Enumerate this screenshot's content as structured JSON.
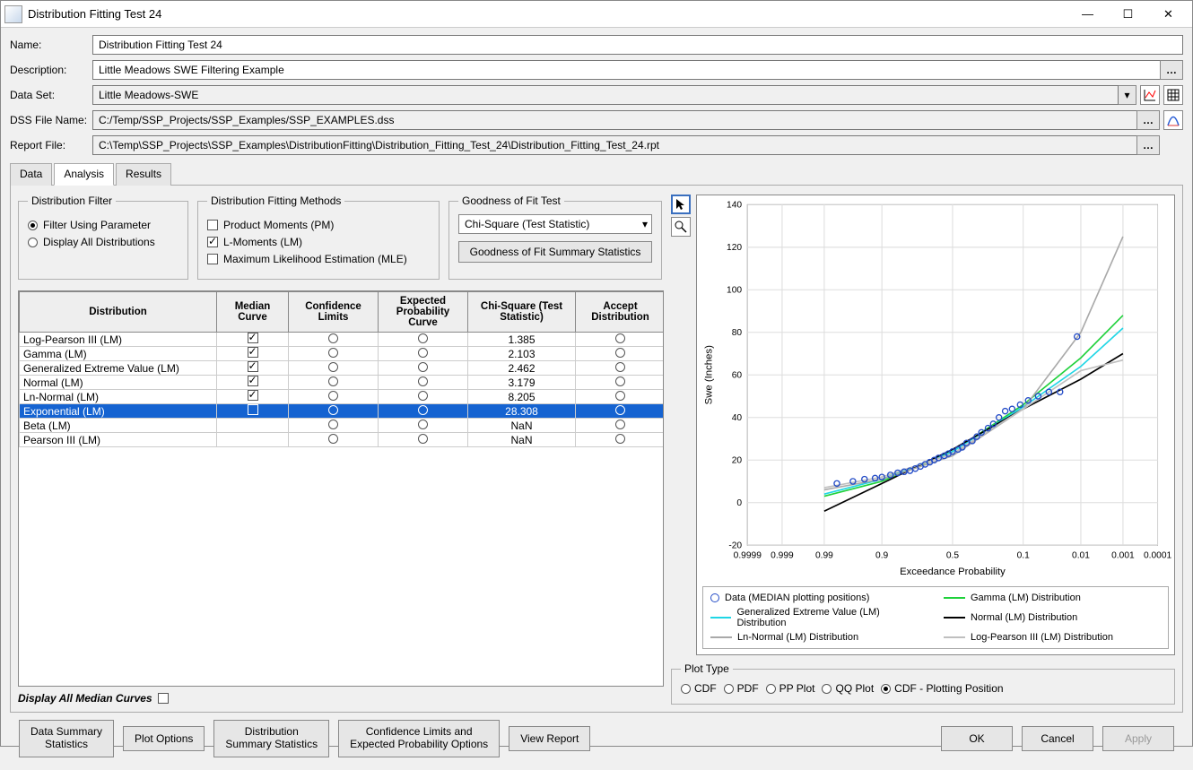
{
  "window": {
    "title": "Distribution Fitting Test 24"
  },
  "form": {
    "name_label": "Name:",
    "name_value": "Distribution Fitting Test 24",
    "description_label": "Description:",
    "description_value": "Little Meadows SWE Filtering Example",
    "dataset_label": "Data Set:",
    "dataset_value": "Little Meadows-SWE",
    "dssfile_label": "DSS File Name:",
    "dssfile_value": "C:/Temp/SSP_Projects/SSP_Examples/SSP_EXAMPLES.dss",
    "report_label": "Report File:",
    "report_value": "C:\\Temp\\SSP_Projects\\SSP_Examples\\DistributionFitting\\Distribution_Fitting_Test_24\\Distribution_Fitting_Test_24.rpt"
  },
  "tabs": {
    "data": "Data",
    "analysis": "Analysis",
    "results": "Results"
  },
  "groups": {
    "dist_filter": {
      "legend": "Distribution Filter",
      "opt_filter": "Filter Using Parameter",
      "opt_display_all": "Display All Distributions"
    },
    "fit_methods": {
      "legend": "Distribution Fitting Methods",
      "pm": "Product Moments (PM)",
      "lm": "L-Moments (LM)",
      "mle": "Maximum Likelihood Estimation (MLE)"
    },
    "gof": {
      "legend": "Goodness of Fit Test",
      "selected": "Chi-Square (Test Statistic)",
      "button": "Goodness of Fit Summary Statistics"
    }
  },
  "table": {
    "headers": {
      "distribution": "Distribution",
      "median": "Median Curve",
      "conf": "Confidence Limits",
      "exp": "Expected Probability Curve",
      "chi": "Chi-Square (Test Statistic)",
      "accept": "Accept Distribution"
    },
    "rows": [
      {
        "name": "Log-Pearson III (LM)",
        "median": true,
        "chi": "1.385",
        "selected": false
      },
      {
        "name": "Gamma (LM)",
        "median": true,
        "chi": "2.103",
        "selected": false
      },
      {
        "name": "Generalized Extreme Value (LM)",
        "median": true,
        "chi": "2.462",
        "selected": false
      },
      {
        "name": "Normal (LM)",
        "median": true,
        "chi": "3.179",
        "selected": false
      },
      {
        "name": "Ln-Normal (LM)",
        "median": true,
        "chi": "8.205",
        "selected": false
      },
      {
        "name": "Exponential (LM)",
        "median": false,
        "chi": "28.308",
        "selected": true
      },
      {
        "name": "Beta (LM)",
        "median": false,
        "chi": "NaN",
        "selected": false,
        "empty": true
      },
      {
        "name": "Pearson III (LM)",
        "median": false,
        "chi": "NaN",
        "selected": false,
        "empty": true
      }
    ]
  },
  "display_all_median": "Display All Median Curves",
  "buttons": {
    "data_summary": "Data Summary\nStatistics",
    "plot_options": "Plot Options",
    "dist_summary": "Distribution\nSummary Statistics",
    "conf_limits": "Confidence Limits and\nExpected Probability Options",
    "view_report": "View Report",
    "ok": "OK",
    "cancel": "Cancel",
    "apply": "Apply"
  },
  "plot_type": {
    "legend": "Plot Type",
    "cdf": "CDF",
    "pdf": "PDF",
    "pp": "PP Plot",
    "qq": "QQ Plot",
    "cdfpp": "CDF - Plotting Position"
  },
  "chart_data": {
    "type": "line",
    "title": "",
    "xlabel": "Exceedance Probability",
    "ylabel": "Swe (Inches)",
    "ylim": [
      -20,
      140
    ],
    "x_ticks": [
      "0.9999",
      "0.999",
      "0.99",
      "0.9",
      "0.5",
      "0.1",
      "0.01",
      "0.001",
      "0.0001"
    ],
    "y_ticks": [
      -20,
      0,
      20,
      40,
      60,
      80,
      100,
      120,
      140
    ],
    "legend": {
      "data_points": "Data (MEDIAN plotting positions)",
      "gamma": "Gamma (LM) Distribution",
      "gev": "Generalized Extreme Value (LM) Distribution",
      "normal": "Normal (LM) Distribution",
      "ln_normal": "Ln-Normal (LM) Distribution",
      "lp3": "Log-Pearson III (LM) Distribution"
    },
    "data_points": [
      {
        "p": 0.982,
        "y": 9
      },
      {
        "p": 0.965,
        "y": 10
      },
      {
        "p": 0.945,
        "y": 11
      },
      {
        "p": 0.92,
        "y": 11.5
      },
      {
        "p": 0.9,
        "y": 12
      },
      {
        "p": 0.87,
        "y": 13
      },
      {
        "p": 0.84,
        "y": 14
      },
      {
        "p": 0.81,
        "y": 14.5
      },
      {
        "p": 0.78,
        "y": 15
      },
      {
        "p": 0.75,
        "y": 16
      },
      {
        "p": 0.72,
        "y": 17
      },
      {
        "p": 0.69,
        "y": 18
      },
      {
        "p": 0.66,
        "y": 19
      },
      {
        "p": 0.63,
        "y": 20
      },
      {
        "p": 0.6,
        "y": 21
      },
      {
        "p": 0.56,
        "y": 22
      },
      {
        "p": 0.53,
        "y": 23
      },
      {
        "p": 0.5,
        "y": 24
      },
      {
        "p": 0.46,
        "y": 25
      },
      {
        "p": 0.43,
        "y": 26
      },
      {
        "p": 0.4,
        "y": 28
      },
      {
        "p": 0.36,
        "y": 29
      },
      {
        "p": 0.33,
        "y": 31
      },
      {
        "p": 0.3,
        "y": 33
      },
      {
        "p": 0.26,
        "y": 35
      },
      {
        "p": 0.23,
        "y": 37
      },
      {
        "p": 0.2,
        "y": 40
      },
      {
        "p": 0.17,
        "y": 43
      },
      {
        "p": 0.14,
        "y": 44
      },
      {
        "p": 0.11,
        "y": 46
      },
      {
        "p": 0.085,
        "y": 48
      },
      {
        "p": 0.06,
        "y": 50
      },
      {
        "p": 0.04,
        "y": 52
      },
      {
        "p": 0.025,
        "y": 52
      },
      {
        "p": 0.012,
        "y": 78
      }
    ],
    "series": [
      {
        "name": "Gamma (LM)",
        "color": "#1fd13b",
        "points": [
          {
            "p": 0.99,
            "y": 3
          },
          {
            "p": 0.9,
            "y": 10
          },
          {
            "p": 0.5,
            "y": 24
          },
          {
            "p": 0.1,
            "y": 46
          },
          {
            "p": 0.01,
            "y": 68
          },
          {
            "p": 0.001,
            "y": 88
          }
        ]
      },
      {
        "name": "Generalized Extreme Value (LM)",
        "color": "#1fd6e5",
        "points": [
          {
            "p": 0.99,
            "y": 4
          },
          {
            "p": 0.9,
            "y": 11
          },
          {
            "p": 0.5,
            "y": 24
          },
          {
            "p": 0.1,
            "y": 45
          },
          {
            "p": 0.01,
            "y": 64
          },
          {
            "p": 0.001,
            "y": 82
          }
        ]
      },
      {
        "name": "Normal (LM)",
        "color": "#000000",
        "points": [
          {
            "p": 0.99,
            "y": -4
          },
          {
            "p": 0.9,
            "y": 9
          },
          {
            "p": 0.5,
            "y": 25
          },
          {
            "p": 0.1,
            "y": 44
          },
          {
            "p": 0.01,
            "y": 58
          },
          {
            "p": 0.001,
            "y": 70
          }
        ]
      },
      {
        "name": "Ln-Normal (LM)",
        "color": "#a9a9a9",
        "points": [
          {
            "p": 0.99,
            "y": 6
          },
          {
            "p": 0.9,
            "y": 11
          },
          {
            "p": 0.5,
            "y": 22
          },
          {
            "p": 0.1,
            "y": 44
          },
          {
            "p": 0.01,
            "y": 80
          },
          {
            "p": 0.001,
            "y": 125
          }
        ]
      },
      {
        "name": "Log-Pearson III (LM)",
        "color": "#bfbfbf",
        "points": [
          {
            "p": 0.99,
            "y": 7
          },
          {
            "p": 0.9,
            "y": 12
          },
          {
            "p": 0.5,
            "y": 23
          },
          {
            "p": 0.1,
            "y": 44
          },
          {
            "p": 0.01,
            "y": 62
          },
          {
            "p": 0.001,
            "y": 67
          }
        ]
      }
    ]
  }
}
